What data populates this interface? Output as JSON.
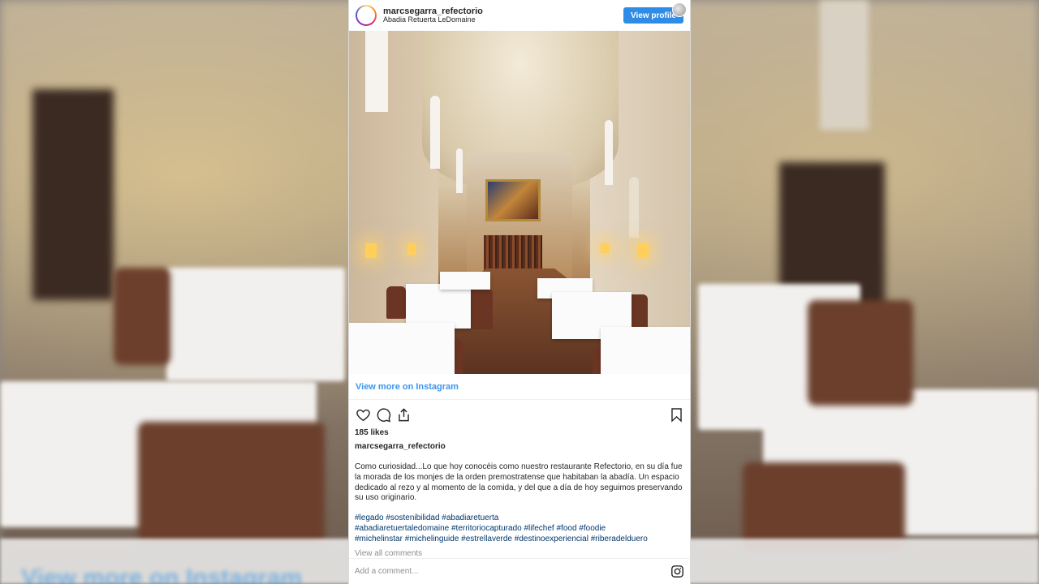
{
  "post": {
    "username": "marcsegarra_refectorio",
    "location": "Abadia Retuerta LeDomaine",
    "view_profile_label": "View profile",
    "view_more_label": "View more on Instagram",
    "likes": "185 likes",
    "caption_user": "marcsegarra_refectorio",
    "caption": "Como curiosidad...Lo que hoy conocéis como nuestro restaurante Refectorio, en su día fue la morada de los monjes de la orden premostratense que habitaban la abadía. Un espacio dedicado al rezo y al momento de la comida, y del que a día de hoy seguimos preservando su uso originario.",
    "hashtags": [
      "#legado #sostenibilidad #abadiaretuerta",
      "#abadiaretuertaledomaine #territoriocapturado #lifechef #food #foodie",
      "#michelinstar #michelinguide #estrellaverde #destinoexperiencial #riberadelduero"
    ],
    "view_all_comments": "View all comments",
    "add_comment_placeholder": "Add a comment..."
  },
  "background": {
    "view_more_label": "View more on Instagram"
  },
  "colors": {
    "accent": "#3897f0",
    "button": "#2f8ce6",
    "hashtag": "#00376b",
    "muted": "#8e8e8e"
  },
  "icons": [
    "heart-icon",
    "comment-icon",
    "share-icon",
    "bookmark-icon",
    "instagram-icon"
  ]
}
